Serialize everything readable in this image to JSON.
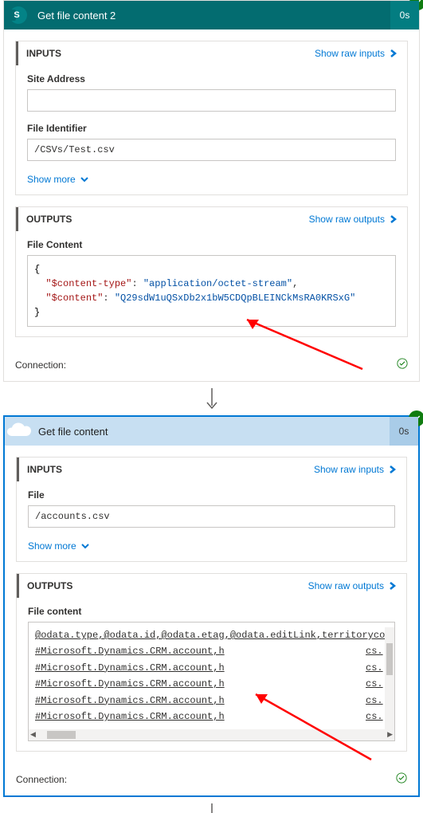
{
  "card1": {
    "title": "Get file content 2",
    "time": "0s",
    "inputs": {
      "header": "INPUTS",
      "show_raw": "Show raw inputs",
      "site_address_label": "Site Address",
      "site_address_value": "",
      "file_identifier_label": "File Identifier",
      "file_identifier_value": "/CSVs/Test.csv",
      "show_more": "Show more"
    },
    "outputs": {
      "header": "OUTPUTS",
      "show_raw": "Show raw outputs",
      "file_content_label": "File Content",
      "json": {
        "open_brace": "{",
        "key1": "\"$content-type\"",
        "colon": ": ",
        "val1": "\"application/octet-stream\"",
        "comma": ",",
        "key2": "\"$content\"",
        "val2": "\"Q29sdW1uQSxDb2x1bW5CDQpBLEINCkMsRA0KRSxG\"",
        "close_brace": "}"
      }
    },
    "connection_label": "Connection:"
  },
  "card2": {
    "title": "Get file content",
    "time": "0s",
    "inputs": {
      "header": "INPUTS",
      "show_raw": "Show raw inputs",
      "file_label": "File",
      "file_value": "/accounts.csv",
      "show_more": "Show more"
    },
    "outputs": {
      "header": "OUTPUTS",
      "show_raw": "Show raw outputs",
      "file_content_label": "File content",
      "row_header": "@odata.type,@odata.id,@odata.etag,@odata.editLink,territorycode@OD",
      "row_body": "#Microsoft.Dynamics.CRM.account,h",
      "row_right": "cs.",
      "rows_count": 5
    },
    "connection_label": "Connection:"
  }
}
